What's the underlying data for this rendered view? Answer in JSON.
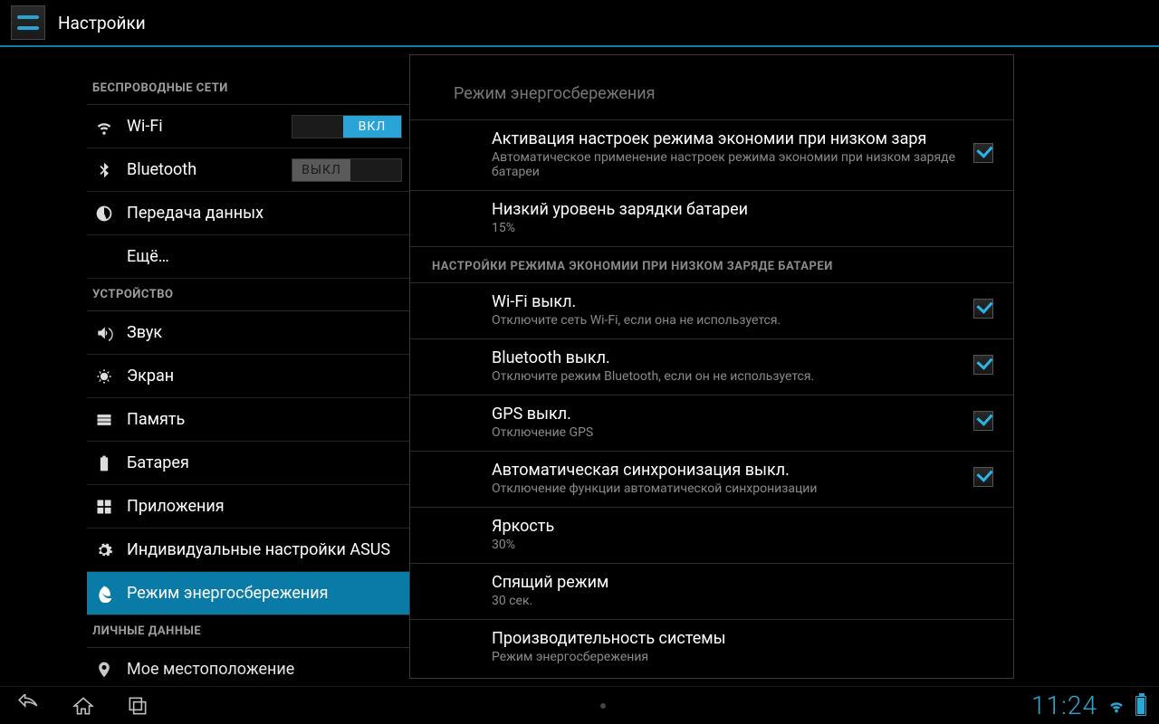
{
  "app_title": "Настройки",
  "sidebar": {
    "sections": [
      {
        "header": "БЕСПРОВОДНЫЕ СЕТИ"
      },
      {
        "header": "УСТРОЙСТВО"
      },
      {
        "header": "ЛИЧНЫЕ ДАННЫЕ"
      }
    ],
    "items": {
      "wifi": {
        "label": "Wi-Fi",
        "switch": "ВКЛ",
        "on": true
      },
      "bluetooth": {
        "label": "Bluetooth",
        "switch": "ВЫКЛ",
        "on": false
      },
      "data": {
        "label": "Передача данных"
      },
      "more": {
        "label": "Ещё…"
      },
      "sound": {
        "label": "Звук"
      },
      "display": {
        "label": "Экран"
      },
      "storage": {
        "label": "Память"
      },
      "battery": {
        "label": "Батарея"
      },
      "apps": {
        "label": "Приложения"
      },
      "asus": {
        "label": "Индивидуальные настройки ASUS"
      },
      "power": {
        "label": "Режим энергосбережения"
      },
      "location": {
        "label": "Мое местоположение"
      }
    }
  },
  "panel": {
    "title": "Режим энергосбережения",
    "section_header": "НАСТРОЙКИ РЕЖИМА ЭКОНОМИИ ПРИ НИЗКОМ ЗАРЯДЕ БАТАРЕИ",
    "rows": {
      "activate": {
        "title": "Активация настроек режима экономии при низком заря",
        "sub": "Автоматическое применение настроек режима экономии при низком заряде батареи",
        "checked": true
      },
      "lowlevel": {
        "title": "Низкий уровень зарядки батареи",
        "sub": "15%"
      },
      "wifi_off": {
        "title": "Wi-Fi выкл.",
        "sub": "Отключите сеть Wi-Fi, если она не используется.",
        "checked": true
      },
      "bt_off": {
        "title": "Bluetooth выкл.",
        "sub": "Отключите режим Bluetooth, если он не используется.",
        "checked": true
      },
      "gps_off": {
        "title": "GPS выкл.",
        "sub": "Отключение GPS",
        "checked": true
      },
      "sync_off": {
        "title": "Автоматическая синхронизация выкл.",
        "sub": "Отключение функции автоматической синхронизации",
        "checked": true
      },
      "brightness": {
        "title": "Яркость",
        "sub": "30%"
      },
      "sleep": {
        "title": "Спящий режим",
        "sub": "30 сек."
      },
      "perf": {
        "title": "Производительность системы",
        "sub": "Режим энергосбережения"
      }
    }
  },
  "statusbar": {
    "clock": "11:24"
  }
}
